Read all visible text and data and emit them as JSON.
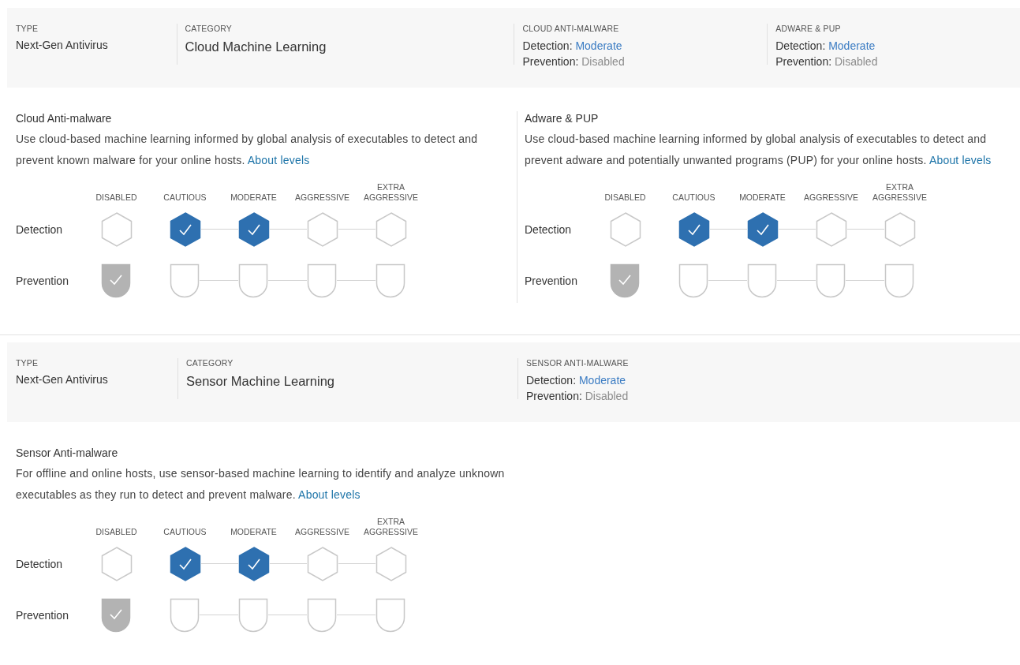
{
  "sections": [
    {
      "summary": {
        "type_label": "TYPE",
        "type": "Next-Gen Antivirus",
        "category_label": "CATEGORY",
        "category": "Cloud Machine Learning",
        "statuses": [
          {
            "heading": "CLOUD ANTI-MALWARE",
            "detection_label": "Detection:",
            "detection": "Moderate",
            "prevention_label": "Prevention:",
            "prevention": "Disabled"
          },
          {
            "heading": "ADWARE & PUP",
            "detection_label": "Detection:",
            "detection": "Moderate",
            "prevention_label": "Prevention:",
            "prevention": "Disabled"
          }
        ]
      },
      "settings": [
        {
          "title": "Cloud Anti-malware",
          "description": "Use cloud-based machine learning informed by global analysis of executables to detect and prevent known malware for your online hosts.",
          "link": "About levels",
          "levels": [
            "DISABLED",
            "CAUTIOUS",
            "MODERATE",
            "AGGRESSIVE",
            "EXTRA AGGRESSIVE"
          ],
          "rows": [
            {
              "label": "Detection",
              "kind": "hexagon",
              "steps": [
                {
                  "checked": false
                },
                {
                  "checked": true
                },
                {
                  "checked": true
                },
                {
                  "checked": false
                },
                {
                  "checked": false
                }
              ]
            },
            {
              "label": "Prevention",
              "kind": "shield",
              "steps": [
                {
                  "checked": true
                },
                {
                  "checked": false
                },
                {
                  "checked": false
                },
                {
                  "checked": false
                },
                {
                  "checked": false
                }
              ]
            }
          ]
        },
        {
          "title": "Adware & PUP",
          "description": "Use cloud-based machine learning informed by global analysis of executables to detect and prevent adware and potentially unwanted programs (PUP) for your online hosts.",
          "link": "About levels",
          "levels": [
            "DISABLED",
            "CAUTIOUS",
            "MODERATE",
            "AGGRESSIVE",
            "EXTRA AGGRESSIVE"
          ],
          "rows": [
            {
              "label": "Detection",
              "kind": "hexagon",
              "steps": [
                {
                  "checked": false
                },
                {
                  "checked": true
                },
                {
                  "checked": true
                },
                {
                  "checked": false
                },
                {
                  "checked": false
                }
              ]
            },
            {
              "label": "Prevention",
              "kind": "shield",
              "steps": [
                {
                  "checked": true
                },
                {
                  "checked": false
                },
                {
                  "checked": false
                },
                {
                  "checked": false
                },
                {
                  "checked": false
                }
              ]
            }
          ]
        }
      ]
    },
    {
      "summary": {
        "type_label": "TYPE",
        "type": "Next-Gen Antivirus",
        "category_label": "CATEGORY",
        "category": "Sensor Machine Learning",
        "statuses": [
          {
            "heading": "SENSOR ANTI-MALWARE",
            "detection_label": "Detection:",
            "detection": "Moderate",
            "prevention_label": "Prevention:",
            "prevention": "Disabled"
          }
        ]
      },
      "settings": [
        {
          "title": "Sensor Anti-malware",
          "description": "For offline and online hosts, use sensor-based machine learning to identify and analyze unknown executables as they run to detect and prevent malware.",
          "link": "About levels",
          "levels": [
            "DISABLED",
            "CAUTIOUS",
            "MODERATE",
            "AGGRESSIVE",
            "EXTRA AGGRESSIVE"
          ],
          "rows": [
            {
              "label": "Detection",
              "kind": "hexagon",
              "steps": [
                {
                  "checked": false
                },
                {
                  "checked": true
                },
                {
                  "checked": true
                },
                {
                  "checked": false
                },
                {
                  "checked": false
                }
              ]
            },
            {
              "label": "Prevention",
              "kind": "shield",
              "steps": [
                {
                  "checked": true
                },
                {
                  "checked": false
                },
                {
                  "checked": false
                },
                {
                  "checked": false
                },
                {
                  "checked": false
                }
              ]
            }
          ]
        }
      ]
    }
  ]
}
